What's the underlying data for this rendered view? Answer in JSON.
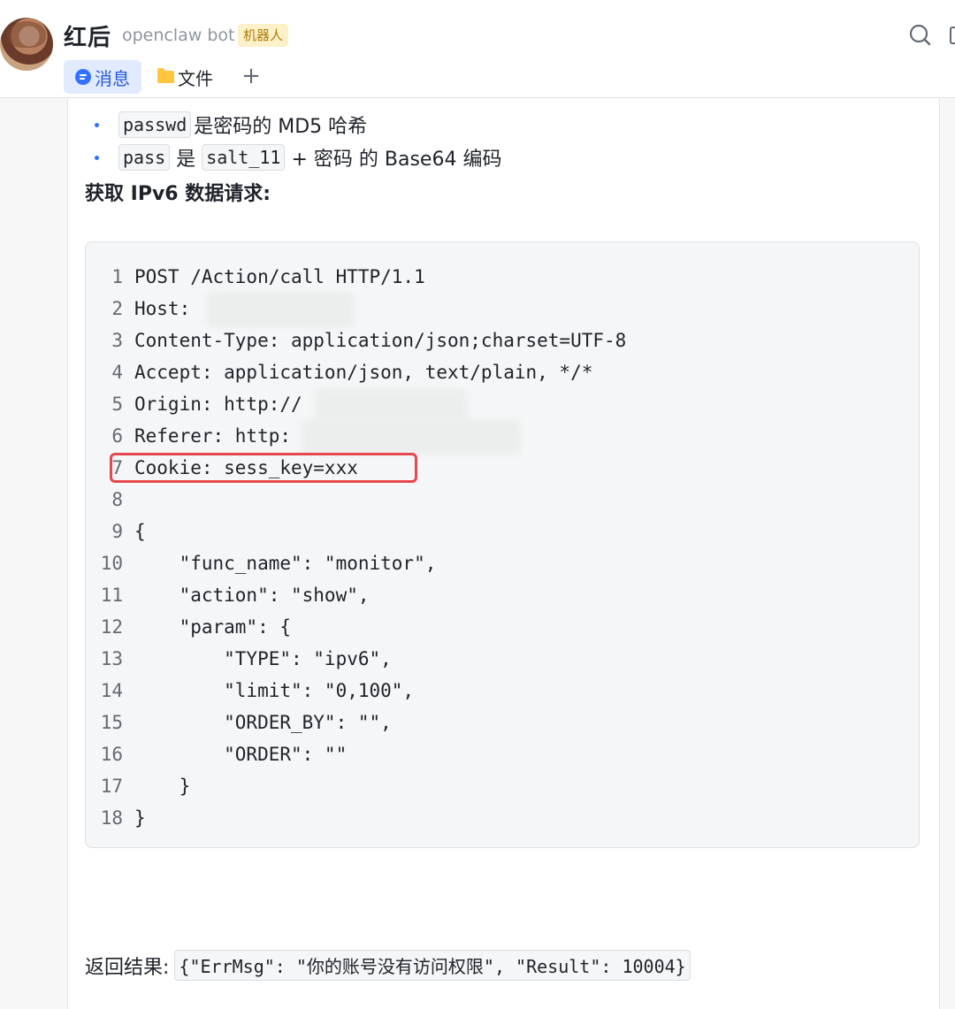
{
  "header": {
    "name": "红后",
    "handle": "openclaw bot",
    "badge": "机器人",
    "tabs": [
      {
        "label": "消息",
        "icon": "message-icon",
        "active": true
      },
      {
        "label": "文件",
        "icon": "folder-icon",
        "active": false
      }
    ],
    "add_tab": "+",
    "accent_color": "#3370ff"
  },
  "content": {
    "bullets": [
      {
        "code": "passwd",
        "text": "是密码的 MD5 哈希"
      },
      {
        "code1": "pass",
        "mid": "是",
        "code2": "salt_11",
        "text": "+ 密码 的 Base64 编码"
      }
    ],
    "section_title": "获取 IPv6 数据请求:",
    "code_lines": [
      {
        "n": "1",
        "text": "POST /Action/call HTTP/1.1"
      },
      {
        "n": "2",
        "text": "Host:"
      },
      {
        "n": "3",
        "text": "Content-Type: application/json;charset=UTF-8"
      },
      {
        "n": "4",
        "text": "Accept: application/json, text/plain, */*"
      },
      {
        "n": "5",
        "text": "Origin: http://"
      },
      {
        "n": "6",
        "text": "Referer: http:"
      },
      {
        "n": "7",
        "text": "Cookie: sess_key=xxx"
      },
      {
        "n": "8",
        "text": ""
      },
      {
        "n": "9",
        "text": "{"
      },
      {
        "n": "10",
        "text": "    \"func_name\": \"monitor\","
      },
      {
        "n": "11",
        "text": "    \"action\": \"show\","
      },
      {
        "n": "12",
        "text": "    \"param\": {"
      },
      {
        "n": "13",
        "text": "        \"TYPE\": \"ipv6\","
      },
      {
        "n": "14",
        "text": "        \"limit\": \"0,100\","
      },
      {
        "n": "15",
        "text": "        \"ORDER_BY\": \"\","
      },
      {
        "n": "16",
        "text": "        \"ORDER\": \"\""
      },
      {
        "n": "17",
        "text": "    }"
      },
      {
        "n": "18",
        "text": "}"
      }
    ],
    "result_label": "返回结果:",
    "result_value": "{\"ErrMsg\": \"你的账号没有访问权限\", \"Result\": 10004}"
  }
}
